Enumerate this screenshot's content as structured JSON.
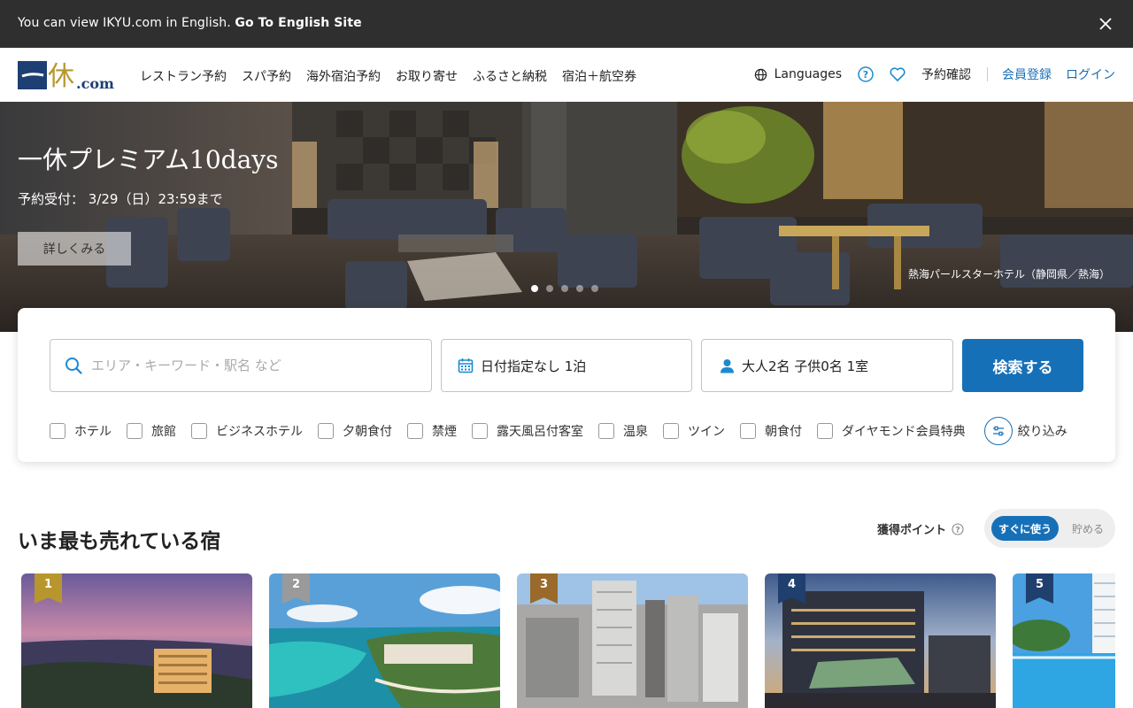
{
  "banner": {
    "message": "You can view IKYU.com in English.",
    "link": "Go To English Site",
    "close_icon": "close-icon"
  },
  "header": {
    "logo_text": "一休.com",
    "nav": [
      "レストラン予約",
      "スパ予約",
      "海外宿泊予約",
      "お取り寄せ",
      "ふるさと納税",
      "宿泊＋航空券"
    ],
    "languages": "Languages",
    "reservation": "予約確認",
    "register": "会員登録",
    "login": "ログイン",
    "accent": "#1b6fb5"
  },
  "hero": {
    "title": "一休プレミアム10days",
    "subtitle": "予約受付： 3/29（日）23:59まで",
    "button": "詳しくみる",
    "caption": "熱海パールスターホテル（静岡県／熱海）",
    "slides": 5,
    "active_slide": 1
  },
  "search": {
    "keyword_placeholder": "エリア・キーワード・駅名 など",
    "date": "日付指定なし 1泊",
    "guests": "大人2名  子供0名  1室",
    "submit": "検索する",
    "filters": [
      "ホテル",
      "旅館",
      "ビジネスホテル",
      "夕朝食付",
      "禁煙",
      "露天風呂付客室",
      "温泉",
      "ツイン",
      "朝食付",
      "ダイヤモンド会員特典"
    ],
    "refine": "絞り込み",
    "button_color": "#1670b8"
  },
  "ranking": {
    "title": "いま最も売れている宿",
    "points_label": "獲得ポイント",
    "toggle_on": "すぐに使う",
    "toggle_off": "貯める",
    "cards": [
      {
        "rank": "1",
        "badge_color": "#b8962e"
      },
      {
        "rank": "2",
        "badge_color": "#9a9a9a"
      },
      {
        "rank": "3",
        "badge_color": "#9a6a2a"
      },
      {
        "rank": "4",
        "badge_color": "#1f3f6e"
      },
      {
        "rank": "5",
        "badge_color": "#1f3f6e"
      }
    ]
  }
}
